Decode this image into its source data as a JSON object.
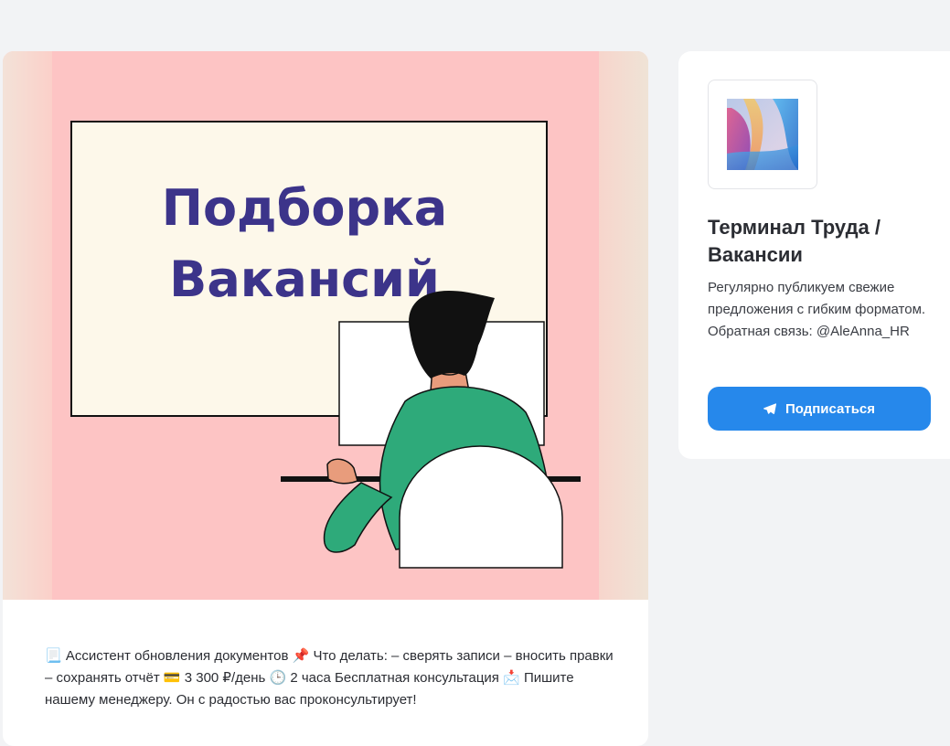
{
  "post": {
    "image": {
      "heading_line1": "Подборка",
      "heading_line2": "Вакансий",
      "colors": {
        "background": "#fdc4c4",
        "board": "#fdf8ea",
        "heading": "#3c348a",
        "shirt": "#2eaa7a",
        "hair": "#111111"
      }
    },
    "text": "📃 Ассистент обновления документов 📌 Что делать: – сверять записи – вносить правки – сохранять отчёт 💳 3 300 ₽/день 🕒 2 часа Бесплатная консультация 📩 Пишите нашему менеджеру. Он с радостью вас проконсультирует!"
  },
  "channel": {
    "avatar_icon": "abstract-gradient-avatar-icon",
    "title": "Терминал Труда / Вакансии",
    "description": "Регулярно публикуем свежие предложения с гибким форматом. Обратная связь: @AleAnna_HR",
    "subscribe_label": "Подписаться",
    "subscribe_icon": "telegram-plane-icon",
    "accent_color": "#2688eb"
  }
}
